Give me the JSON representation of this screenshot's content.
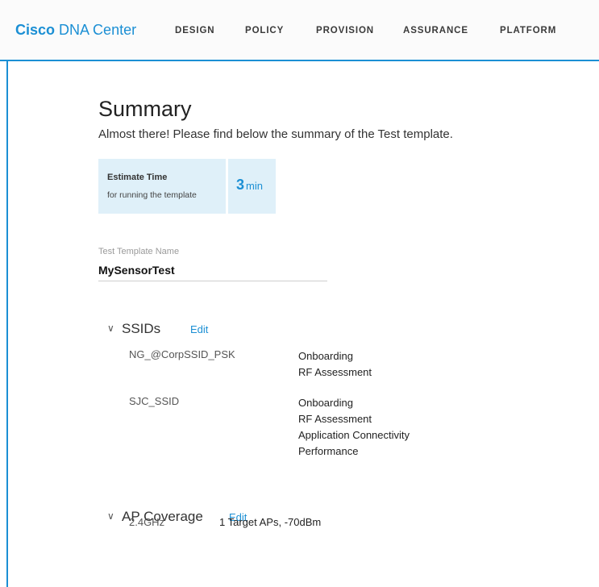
{
  "header": {
    "brand_bold": "Cisco",
    "brand_rest": "DNA Center",
    "nav": [
      "DESIGN",
      "POLICY",
      "PROVISION",
      "ASSURANCE",
      "PLATFORM"
    ]
  },
  "summary": {
    "title": "Summary",
    "subtitle": "Almost there! Please find below the summary of the Test template."
  },
  "estimate": {
    "label": "Estimate Time",
    "sublabel": "for running the template",
    "value": "3",
    "unit": "min"
  },
  "template_name": {
    "label": "Test Template Name",
    "value": "MySensorTest"
  },
  "ssids": {
    "heading": "SSIDs",
    "edit_label": "Edit",
    "items": [
      {
        "name": "NG_@CorpSSID_PSK",
        "tests": [
          "Onboarding",
          "RF Assessment"
        ]
      },
      {
        "name": "SJC_SSID",
        "tests": [
          "Onboarding",
          "RF Assessment",
          "Application Connectivity",
          "Performance"
        ]
      }
    ]
  },
  "ap_coverage": {
    "heading": "AP Coverage",
    "edit_label": "Edit",
    "band": "2.4GHz",
    "detail": "1 Target APs, -70dBm"
  },
  "colors": {
    "accent": "#1b8fd4",
    "estimate_bg": "#dff0f9"
  },
  "icons": {
    "section_toggle": "chevron-down-icon"
  }
}
